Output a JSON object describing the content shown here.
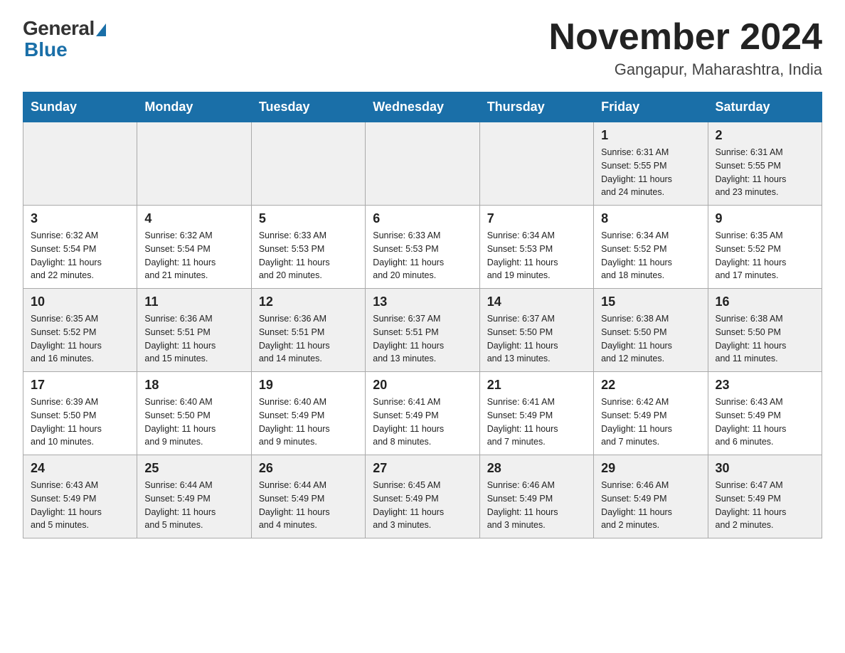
{
  "header": {
    "logo_general": "General",
    "logo_blue": "Blue",
    "month_title": "November 2024",
    "location": "Gangapur, Maharashtra, India"
  },
  "weekdays": [
    "Sunday",
    "Monday",
    "Tuesday",
    "Wednesday",
    "Thursday",
    "Friday",
    "Saturday"
  ],
  "weeks": [
    [
      {
        "day": "",
        "info": ""
      },
      {
        "day": "",
        "info": ""
      },
      {
        "day": "",
        "info": ""
      },
      {
        "day": "",
        "info": ""
      },
      {
        "day": "",
        "info": ""
      },
      {
        "day": "1",
        "info": "Sunrise: 6:31 AM\nSunset: 5:55 PM\nDaylight: 11 hours\nand 24 minutes."
      },
      {
        "day": "2",
        "info": "Sunrise: 6:31 AM\nSunset: 5:55 PM\nDaylight: 11 hours\nand 23 minutes."
      }
    ],
    [
      {
        "day": "3",
        "info": "Sunrise: 6:32 AM\nSunset: 5:54 PM\nDaylight: 11 hours\nand 22 minutes."
      },
      {
        "day": "4",
        "info": "Sunrise: 6:32 AM\nSunset: 5:54 PM\nDaylight: 11 hours\nand 21 minutes."
      },
      {
        "day": "5",
        "info": "Sunrise: 6:33 AM\nSunset: 5:53 PM\nDaylight: 11 hours\nand 20 minutes."
      },
      {
        "day": "6",
        "info": "Sunrise: 6:33 AM\nSunset: 5:53 PM\nDaylight: 11 hours\nand 20 minutes."
      },
      {
        "day": "7",
        "info": "Sunrise: 6:34 AM\nSunset: 5:53 PM\nDaylight: 11 hours\nand 19 minutes."
      },
      {
        "day": "8",
        "info": "Sunrise: 6:34 AM\nSunset: 5:52 PM\nDaylight: 11 hours\nand 18 minutes."
      },
      {
        "day": "9",
        "info": "Sunrise: 6:35 AM\nSunset: 5:52 PM\nDaylight: 11 hours\nand 17 minutes."
      }
    ],
    [
      {
        "day": "10",
        "info": "Sunrise: 6:35 AM\nSunset: 5:52 PM\nDaylight: 11 hours\nand 16 minutes."
      },
      {
        "day": "11",
        "info": "Sunrise: 6:36 AM\nSunset: 5:51 PM\nDaylight: 11 hours\nand 15 minutes."
      },
      {
        "day": "12",
        "info": "Sunrise: 6:36 AM\nSunset: 5:51 PM\nDaylight: 11 hours\nand 14 minutes."
      },
      {
        "day": "13",
        "info": "Sunrise: 6:37 AM\nSunset: 5:51 PM\nDaylight: 11 hours\nand 13 minutes."
      },
      {
        "day": "14",
        "info": "Sunrise: 6:37 AM\nSunset: 5:50 PM\nDaylight: 11 hours\nand 13 minutes."
      },
      {
        "day": "15",
        "info": "Sunrise: 6:38 AM\nSunset: 5:50 PM\nDaylight: 11 hours\nand 12 minutes."
      },
      {
        "day": "16",
        "info": "Sunrise: 6:38 AM\nSunset: 5:50 PM\nDaylight: 11 hours\nand 11 minutes."
      }
    ],
    [
      {
        "day": "17",
        "info": "Sunrise: 6:39 AM\nSunset: 5:50 PM\nDaylight: 11 hours\nand 10 minutes."
      },
      {
        "day": "18",
        "info": "Sunrise: 6:40 AM\nSunset: 5:50 PM\nDaylight: 11 hours\nand 9 minutes."
      },
      {
        "day": "19",
        "info": "Sunrise: 6:40 AM\nSunset: 5:49 PM\nDaylight: 11 hours\nand 9 minutes."
      },
      {
        "day": "20",
        "info": "Sunrise: 6:41 AM\nSunset: 5:49 PM\nDaylight: 11 hours\nand 8 minutes."
      },
      {
        "day": "21",
        "info": "Sunrise: 6:41 AM\nSunset: 5:49 PM\nDaylight: 11 hours\nand 7 minutes."
      },
      {
        "day": "22",
        "info": "Sunrise: 6:42 AM\nSunset: 5:49 PM\nDaylight: 11 hours\nand 7 minutes."
      },
      {
        "day": "23",
        "info": "Sunrise: 6:43 AM\nSunset: 5:49 PM\nDaylight: 11 hours\nand 6 minutes."
      }
    ],
    [
      {
        "day": "24",
        "info": "Sunrise: 6:43 AM\nSunset: 5:49 PM\nDaylight: 11 hours\nand 5 minutes."
      },
      {
        "day": "25",
        "info": "Sunrise: 6:44 AM\nSunset: 5:49 PM\nDaylight: 11 hours\nand 5 minutes."
      },
      {
        "day": "26",
        "info": "Sunrise: 6:44 AM\nSunset: 5:49 PM\nDaylight: 11 hours\nand 4 minutes."
      },
      {
        "day": "27",
        "info": "Sunrise: 6:45 AM\nSunset: 5:49 PM\nDaylight: 11 hours\nand 3 minutes."
      },
      {
        "day": "28",
        "info": "Sunrise: 6:46 AM\nSunset: 5:49 PM\nDaylight: 11 hours\nand 3 minutes."
      },
      {
        "day": "29",
        "info": "Sunrise: 6:46 AM\nSunset: 5:49 PM\nDaylight: 11 hours\nand 2 minutes."
      },
      {
        "day": "30",
        "info": "Sunrise: 6:47 AM\nSunset: 5:49 PM\nDaylight: 11 hours\nand 2 minutes."
      }
    ]
  ]
}
